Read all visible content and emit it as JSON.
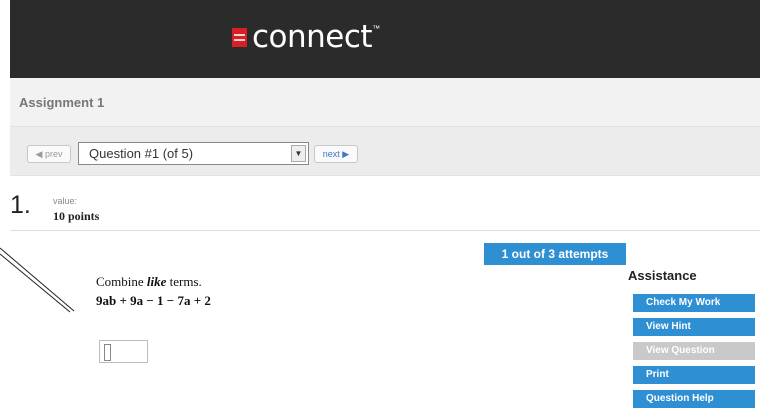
{
  "brand": {
    "name": "connect",
    "tm": "™",
    "accent_color": "#d81f26"
  },
  "assignment": {
    "title": "Assignment 1"
  },
  "nav": {
    "prev_label": "◀ prev",
    "next_label": "next ▶",
    "question_select": {
      "value": "Question #1 (of 5)"
    }
  },
  "question": {
    "number": "1.",
    "value_label": "value:",
    "points": "10 points",
    "instruction_prefix": "Combine ",
    "instruction_emph": "like",
    "instruction_suffix": " terms.",
    "expression": "9ab + 9a − 1 − 7a + 2"
  },
  "attempts": {
    "label": "1 out of 3 attempts"
  },
  "assistance": {
    "title": "Assistance",
    "buttons": [
      {
        "label": "Check My Work",
        "enabled": true
      },
      {
        "label": "View Hint",
        "enabled": true
      },
      {
        "label": "View Question",
        "enabled": false
      },
      {
        "label": "Print",
        "enabled": true
      },
      {
        "label": "Question Help",
        "enabled": true
      }
    ]
  },
  "colors": {
    "button_blue": "#2e8fd3",
    "header_bg": "#2b2b2b",
    "disabled": "#c9c9c9"
  }
}
